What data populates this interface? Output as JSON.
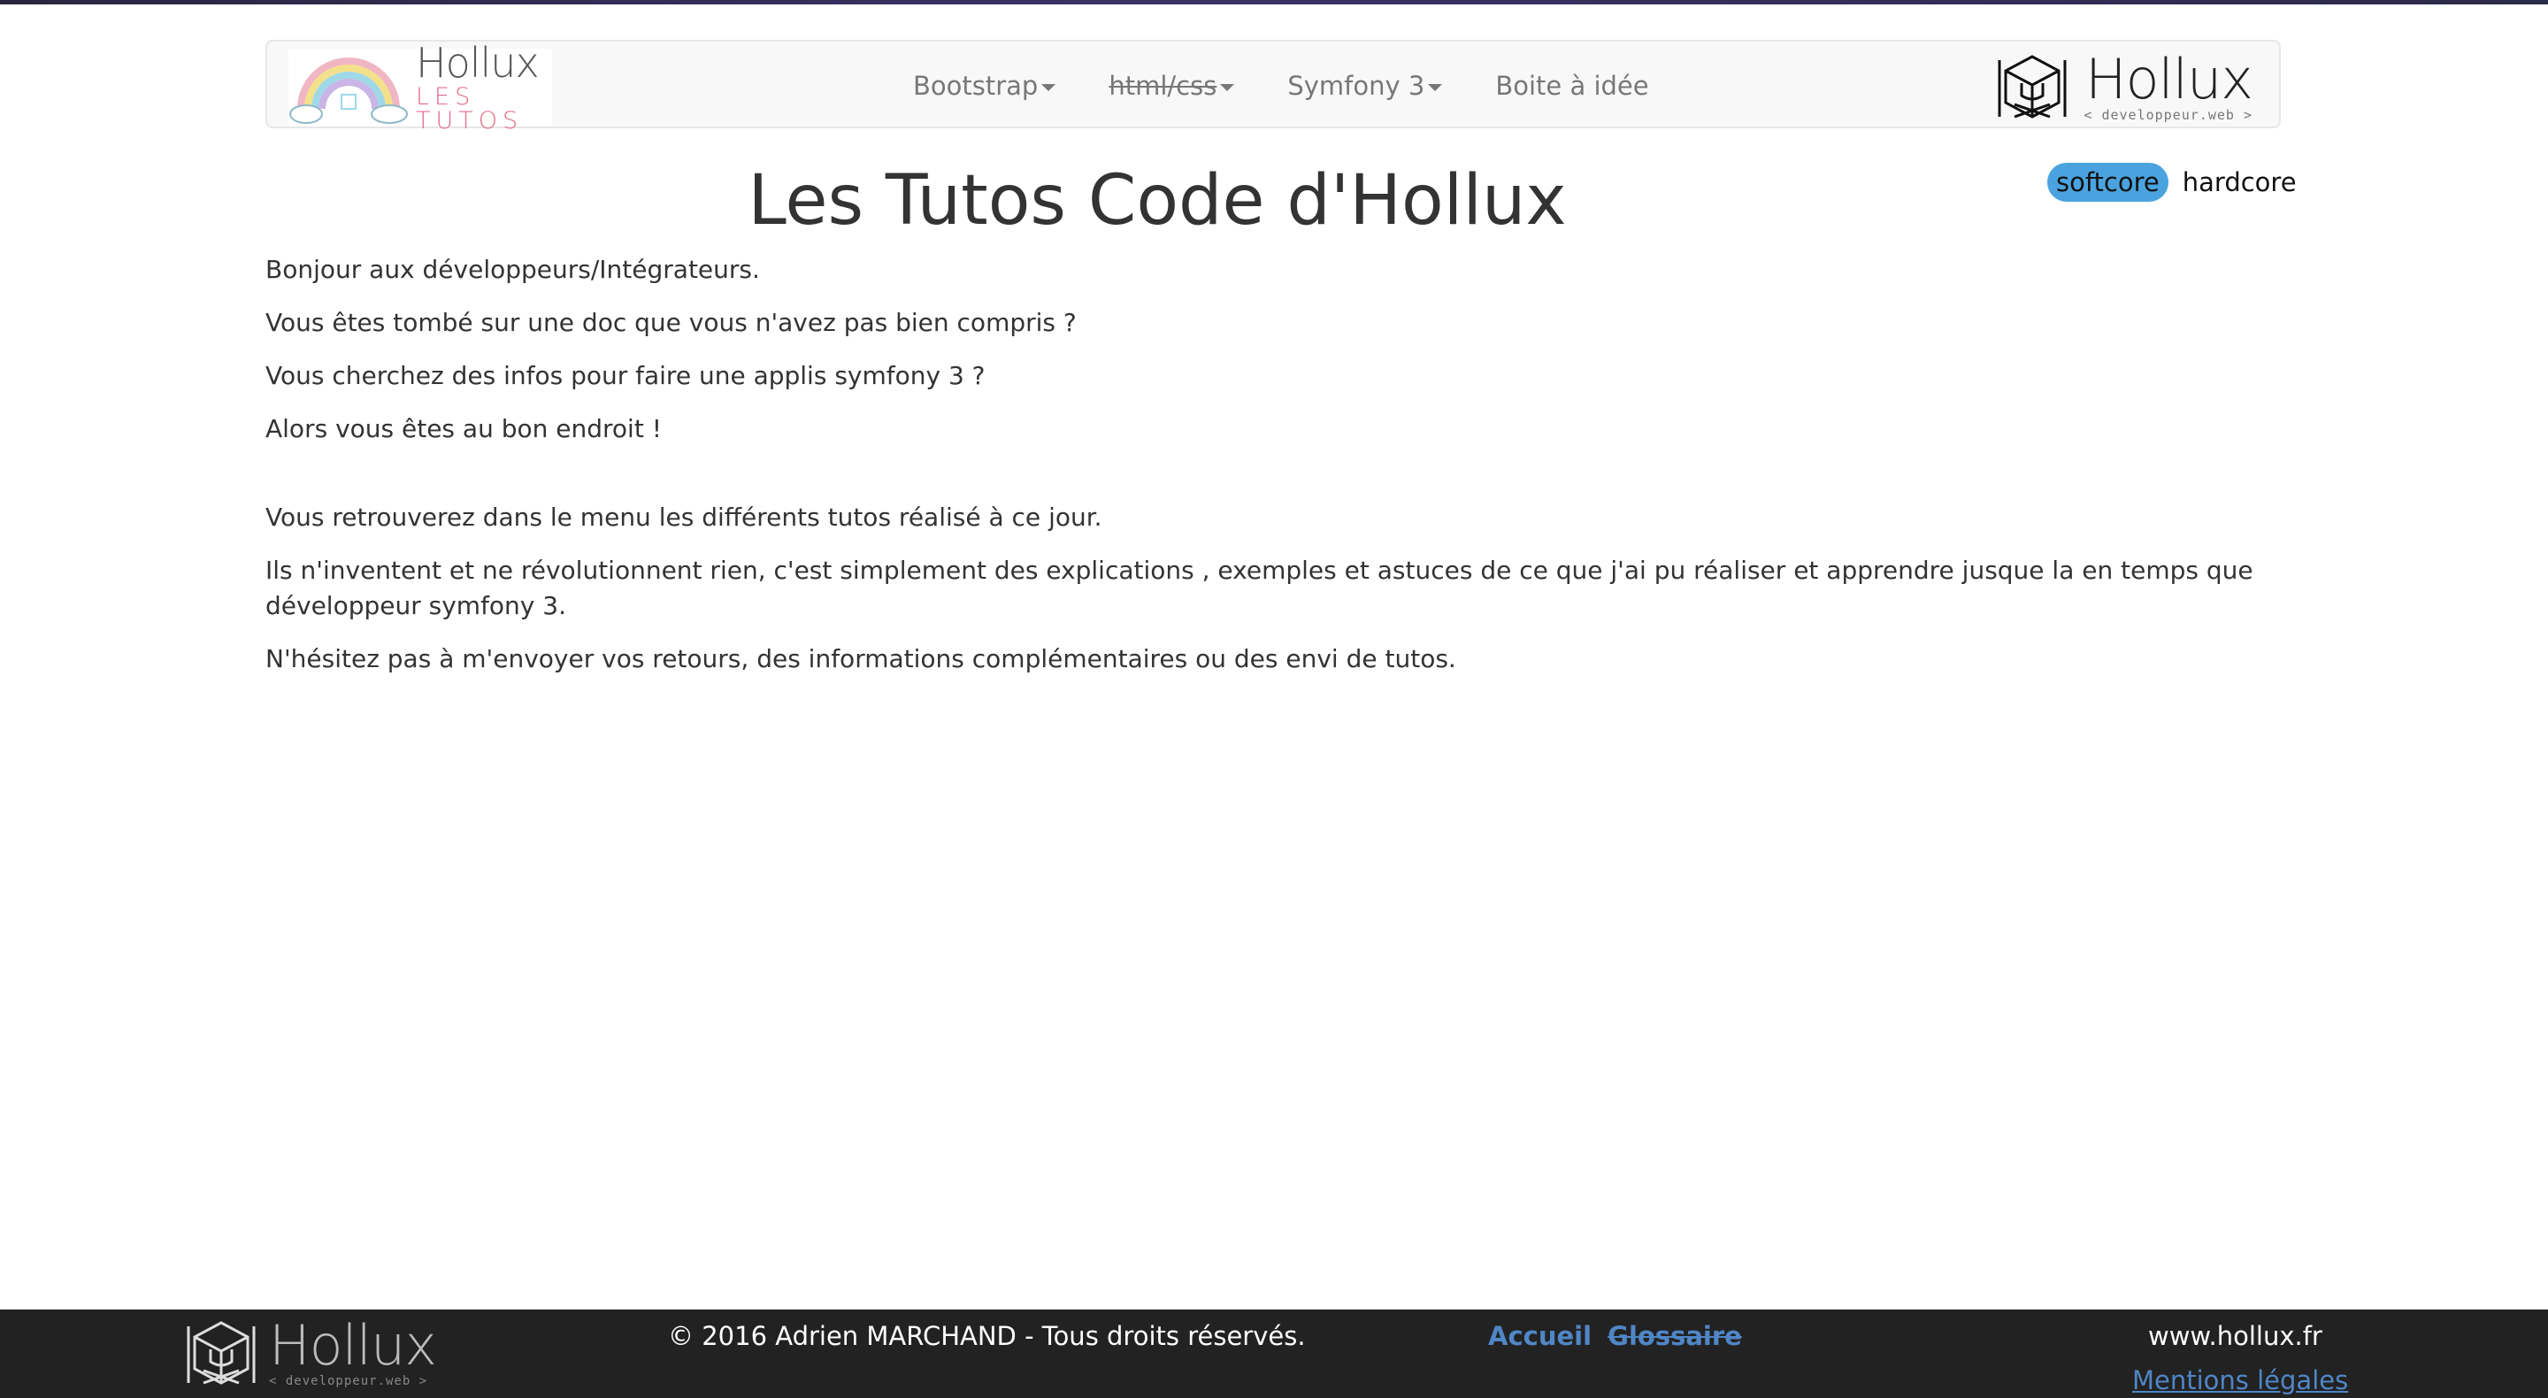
{
  "header": {
    "brand_left": {
      "name": "Hollux",
      "subtitle": "LES TUTOS"
    },
    "nav": [
      {
        "label": "Bootstrap"
      },
      {
        "label": "html/css"
      },
      {
        "label": "Symfony 3"
      },
      {
        "label": "Boite à idée"
      }
    ],
    "brand_right": {
      "name": "Hollux",
      "subtitle": "< developpeur.web >"
    }
  },
  "mode_toggle": {
    "softcore": "softcore",
    "hardcore": "hardcore"
  },
  "page": {
    "title": "Les Tutos Code d'Hollux",
    "paragraphs": [
      "Bonjour aux développeurs/Intégrateurs.",
      "Vous êtes tombé sur une doc que vous n'avez pas bien compris ?",
      "Vous cherchez des infos pour faire une applis symfony 3 ?",
      "Alors vous êtes au bon endroit !",
      "Vous retrouverez dans le menu les différents tutos réalisé à ce jour.",
      "Ils n'inventent et ne révolutionnent rien, c'est simplement des explications , exemples et astuces de ce que j'ai pu réaliser et apprendre jusque la en temps que développeur symfony 3.",
      "N'hésitez pas à m'envoyer vos retours, des informations complémentaires ou des envi de tutos."
    ]
  },
  "footer": {
    "logo": {
      "name": "Hollux",
      "subtitle": "< developpeur.web >"
    },
    "copyright": "© 2016 Adrien MARCHAND - Tous droits réservés.",
    "links": {
      "home": "Accueil",
      "glossary": "Glossaire"
    },
    "site": "www.hollux.fr",
    "legal": "Mentions légales"
  },
  "colors": {
    "accent_blue": "#4aa3df",
    "link_blue": "#4f86c6",
    "footer_bg": "#222222",
    "navbar_bg": "#f8f8f8"
  }
}
